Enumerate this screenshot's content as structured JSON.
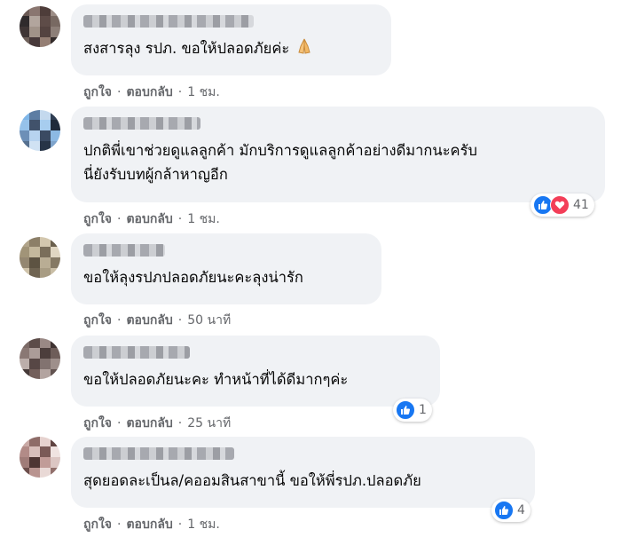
{
  "reaction_colors": {
    "like": "#1877f2",
    "love": "#f33e58"
  },
  "comments": [
    {
      "text": "สงสารลุง รปภ. ขอให้ปลอดภัยค่ะ",
      "emoji": "folded-hands",
      "like": "ถูกใจ",
      "reply": "ตอบกลับ",
      "time": "1 ชม.",
      "avatar_colors": [
        "#6b5a55",
        "#8a7670",
        "#4e3d3a",
        "#9c8d86",
        "#2f2a2c",
        "#b2a59d",
        "#5e4c48",
        "#786962",
        "#3f3535",
        "#a19389",
        "#544340",
        "#8d7f78",
        "#6f615b",
        "#47393a",
        "#957f74",
        "#332b2a"
      ]
    },
    {
      "text": "ปกติพี่เขาช่วยดูแลลูกค้า มักบริการดูแลลูกค้าอย่างดีมากนะครับ\nนี่ยังรับบทผู้กล้าหาญอีก",
      "like": "ถูกใจ",
      "reply": "ตอบกลับ",
      "time": "1 ชม.",
      "reaction_count": "41",
      "reactions": [
        "like-icon",
        "love-icon"
      ],
      "avatar_colors": [
        "#7fb6e8",
        "#5d7da3",
        "#c4d9ee",
        "#2e3d52",
        "#96c2ea",
        "#41526b",
        "#a7cdef",
        "#1f2a3a",
        "#6d8fb7",
        "#b7d3ef",
        "#3a4a62",
        "#8cb9e3",
        "#56708f",
        "#d0e2f3",
        "#273447",
        "#7ea4cc"
      ]
    },
    {
      "text": "ขอให้ลุงรปภปลอดภัยนะคะลุงน่ารัก",
      "like": "ถูกใจ",
      "reply": "ตอบกลับ",
      "time": "50 นาที",
      "avatar_colors": [
        "#b1a48a",
        "#8c7f68",
        "#d3c7ae",
        "#6a5f4d",
        "#a19478",
        "#c4b89d",
        "#7a6e5a",
        "#e0d6c2",
        "#948771",
        "#5d5342",
        "#b9ad94",
        "#857964",
        "#cfc3aa",
        "#6f6452",
        "#a89c83",
        "#c9bea6"
      ]
    },
    {
      "text": "ขอให้ปลอดภัยนะคะ ทำหน้าที่ได้ดีมากๆค่ะ",
      "like": "ถูกใจ",
      "reply": "ตอบกลับ",
      "time": "25 นาที",
      "reaction_count": "1",
      "reactions": [
        "like-icon"
      ],
      "avatar_colors": [
        "#7b6a66",
        "#5c4c49",
        "#9a8985",
        "#3e3231",
        "#8a7874",
        "#ab9c98",
        "#4c3e3c",
        "#6e5d59",
        "#bcaeaa",
        "#574745",
        "#827370",
        "#9e8f8b",
        "#463a38",
        "#735f5b",
        "#b3a4a0",
        "#625350"
      ]
    },
    {
      "text": "สุดยอดละเป็นล/คออมสินสาขานี้ ขอให้พี่รปภ.ปลอดภัย",
      "like": "ถูกใจ",
      "reply": "ตอบกลับ",
      "time": "1 ชม.",
      "reaction_count": "4",
      "reactions": [
        "like-icon"
      ],
      "avatar_colors": [
        "#c9a9a5",
        "#8e6c68",
        "#e6d2cf",
        "#5f4341",
        "#b28b87",
        "#d8bfbb",
        "#7a5a57",
        "#f0e3e1",
        "#a07c78",
        "#4e3533",
        "#c19c98",
        "#dcc6c3",
        "#6c4e4b",
        "#b99490",
        "#e9d9d6",
        "#916f6b"
      ]
    }
  ]
}
